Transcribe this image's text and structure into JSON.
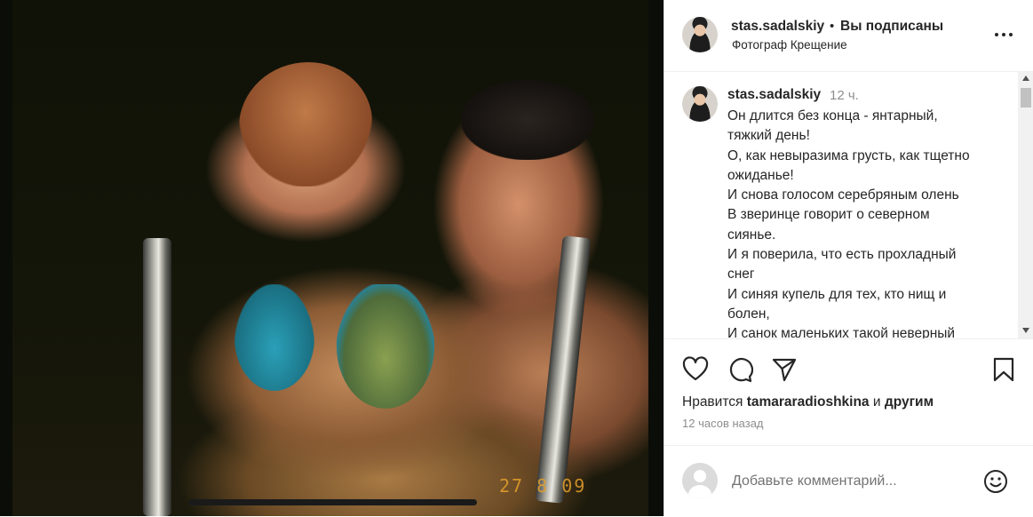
{
  "post": {
    "username": "stas.sadalskiy",
    "separator": "•",
    "follow_status": "Вы подписаны",
    "location": "Фотограф Крещение",
    "more_icon": "more-icon",
    "photo_stamp": "27 8 09"
  },
  "caption": {
    "username": "stas.sadalskiy",
    "time": "12 ч.",
    "lines": [
      "Он длится без конца - янтарный,",
      "тяжкий день!",
      "О, как невыразима грусть, как тщетно",
      "ожиданье!",
      "И снова голосом серебряным олень",
      "В зверинце говорит о северном",
      "сиянье.",
      "И я поверила, что есть прохладный",
      "снег",
      "И синяя купель для тех, кто нищ и",
      "болен,",
      "И санок маленьких такой неверный"
    ]
  },
  "actions": {
    "likes_prefix": "Нравится",
    "likes_user": "tamararadioshkina",
    "likes_and": "и",
    "likes_others": "другим",
    "posted_ago": "12 часов назад"
  },
  "comment": {
    "placeholder": "Добавьте комментарий..."
  }
}
